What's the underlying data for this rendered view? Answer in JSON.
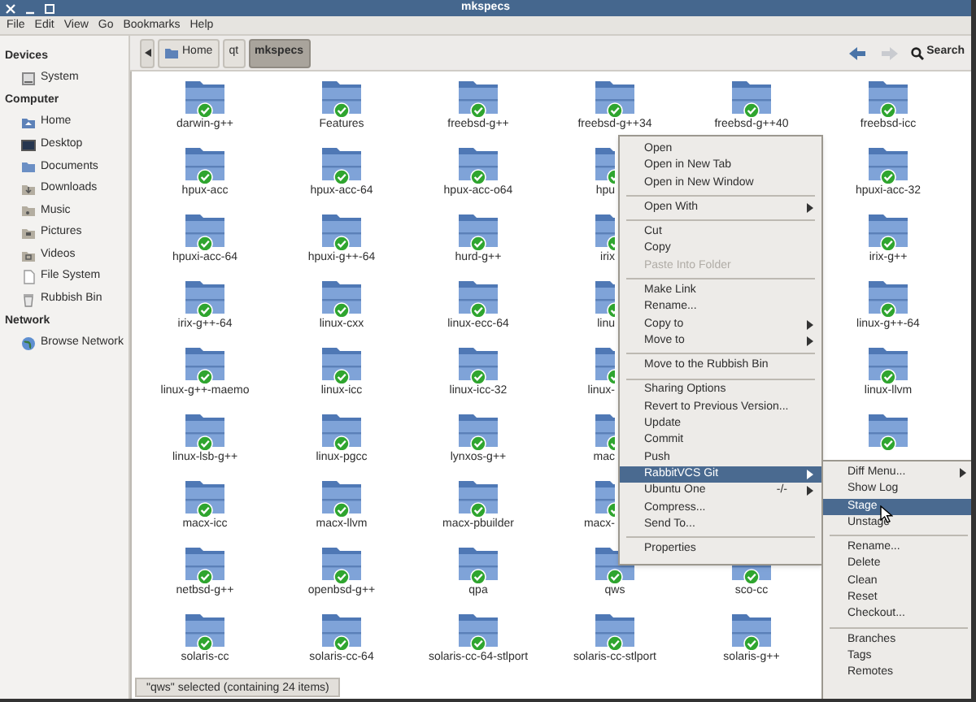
{
  "window": {
    "title": "mkspecs"
  },
  "menu_bar": [
    "File",
    "Edit",
    "View",
    "Go",
    "Bookmarks",
    "Help"
  ],
  "sidebar": [
    {
      "heading": "Devices",
      "items": [
        {
          "label": "System"
        }
      ]
    },
    {
      "heading": "Computer",
      "items": [
        {
          "label": "Home"
        },
        {
          "label": "Desktop"
        },
        {
          "label": "Documents"
        },
        {
          "label": "Downloads"
        },
        {
          "label": "Music"
        },
        {
          "label": "Pictures"
        },
        {
          "label": "Videos"
        },
        {
          "label": "File System"
        },
        {
          "label": "Rubbish Bin"
        }
      ]
    },
    {
      "heading": "Network",
      "items": [
        {
          "label": "Browse Network"
        }
      ]
    }
  ],
  "path_bar": [
    {
      "label": "Home",
      "selected": false
    },
    {
      "label": "qt",
      "selected": false
    },
    {
      "label": "mkspecs",
      "selected": true
    }
  ],
  "search_button": "Search",
  "folders": [
    {
      "before_menu": [
        {
          "name": "darwin-g++",
          "partial": false
        },
        {
          "name": "Features",
          "partial": false
        },
        {
          "name": "freebsd-g++",
          "partial": false
        },
        {
          "name": "freebsd-g++34",
          "partial": false
        },
        {
          "name": "freebsd-g++40",
          "partial": false
        },
        {
          "name": "freebsd-icc",
          "partial": false
        }
      ]
    },
    {
      "before_menu": [
        {
          "name": "hpux-acc",
          "partial": false
        },
        {
          "name": "hpux-acc-64",
          "partial": false
        },
        {
          "name": "hpux-acc-o64",
          "partial": false
        },
        {
          "name": "hpu",
          "partial": true
        }
      ],
      "after_menu": [
        {
          "name": "hpuxi-acc-32",
          "partial": false
        }
      ]
    },
    {
      "before_menu": [
        {
          "name": "hpuxi-acc-64",
          "partial": false
        },
        {
          "name": "hpuxi-g++-64",
          "partial": false
        },
        {
          "name": "hurd-g++",
          "partial": false
        },
        {
          "name": "irix",
          "partial": true
        }
      ],
      "after_menu": [
        {
          "name": "irix-g++",
          "partial": false
        }
      ]
    },
    {
      "before_menu": [
        {
          "name": "irix-g++-64",
          "partial": false
        },
        {
          "name": "linux-cxx",
          "partial": false
        },
        {
          "name": "linux-ecc-64",
          "partial": false
        },
        {
          "name": "linu",
          "partial": true
        }
      ],
      "after_menu": [
        {
          "name": "linux-g++-64",
          "partial": false
        }
      ]
    },
    {
      "before_menu": [
        {
          "name": "linux-g++-maemo",
          "partial": false
        },
        {
          "name": "linux-icc",
          "partial": false
        },
        {
          "name": "linux-icc-32",
          "partial": false
        },
        {
          "name": "linux-",
          "partial": true
        }
      ],
      "after_menu": [
        {
          "name": "linux-llvm",
          "partial": false
        }
      ]
    },
    {
      "before_menu": [
        {
          "name": "linux-lsb-g++",
          "partial": false
        },
        {
          "name": "linux-pgcc",
          "partial": false
        },
        {
          "name": "lynxos-g++",
          "partial": false
        },
        {
          "name": "mac",
          "partial": true
        }
      ],
      "after_menu": [
        {
          "partial": false
        }
      ]
    },
    {
      "before_menu": [
        {
          "name": "macx-icc",
          "partial": false
        },
        {
          "name": "macx-llvm",
          "partial": false
        },
        {
          "name": "macx-pbuilder",
          "partial": false
        },
        {
          "name": "macx-",
          "partial": true
        }
      ]
    },
    {
      "before_menu": [
        {
          "name": "netbsd-g++",
          "partial": false
        },
        {
          "name": "openbsd-g++",
          "partial": false
        },
        {
          "name": "qpa",
          "partial": false
        },
        {
          "name": "qws",
          "partial": false
        },
        {
          "name": "sco-cc",
          "partial": false
        }
      ]
    },
    {
      "before_menu": [
        {
          "name": "solaris-cc",
          "partial": false
        },
        {
          "name": "solaris-cc-64",
          "partial": false
        },
        {
          "name": "solaris-cc-64-stlport",
          "partial": false
        },
        {
          "name": "solaris-cc-stlport",
          "partial": false
        },
        {
          "name": "solaris-g++",
          "partial": false
        }
      ]
    }
  ],
  "status_bar": "\"qws\" selected (containing 24 items)",
  "context_menu": [
    {
      "kind": "item",
      "label": "Open",
      "has_submenu": false,
      "selected": false,
      "disabled": false
    },
    {
      "kind": "item",
      "label": "Open in New Tab",
      "has_submenu": false,
      "selected": false,
      "disabled": false
    },
    {
      "kind": "item",
      "label": "Open in New Window",
      "has_submenu": false,
      "selected": false,
      "disabled": false
    },
    {
      "kind": "separator"
    },
    {
      "kind": "item",
      "label": "Open With",
      "has_submenu": true,
      "selected": false,
      "disabled": false
    },
    {
      "kind": "separator"
    },
    {
      "kind": "item",
      "label": "Cut",
      "has_submenu": false,
      "selected": false,
      "disabled": false
    },
    {
      "kind": "item",
      "label": "Copy",
      "has_submenu": false,
      "selected": false,
      "disabled": false
    },
    {
      "kind": "item",
      "label": "Paste Into Folder",
      "has_submenu": false,
      "selected": false,
      "disabled": true
    },
    {
      "kind": "separator"
    },
    {
      "kind": "item",
      "label": "Make Link",
      "has_submenu": false,
      "selected": false,
      "disabled": false
    },
    {
      "kind": "item",
      "label": "Rename...",
      "has_submenu": false,
      "selected": false,
      "disabled": false
    },
    {
      "kind": "item",
      "label": "Copy to",
      "has_submenu": true,
      "selected": false,
      "disabled": false
    },
    {
      "kind": "item",
      "label": "Move to",
      "has_submenu": true,
      "selected": false,
      "disabled": false
    },
    {
      "kind": "separator"
    },
    {
      "kind": "item",
      "label": "Move to the Rubbish Bin",
      "has_submenu": false,
      "selected": false,
      "disabled": false
    },
    {
      "kind": "separator"
    },
    {
      "kind": "item",
      "label": "Sharing Options",
      "has_submenu": false,
      "selected": false,
      "disabled": false
    },
    {
      "kind": "item",
      "label": "Revert to Previous Version...",
      "has_submenu": false,
      "selected": false,
      "disabled": false
    },
    {
      "kind": "item",
      "label": "Update",
      "has_submenu": false,
      "selected": false,
      "disabled": false
    },
    {
      "kind": "item",
      "label": "Commit",
      "has_submenu": false,
      "selected": false,
      "disabled": false
    },
    {
      "kind": "item",
      "label": "Push",
      "has_submenu": false,
      "selected": false,
      "disabled": false
    },
    {
      "kind": "item",
      "label": "RabbitVCS Git",
      "has_submenu": true,
      "selected": true,
      "disabled": false
    },
    {
      "kind": "item",
      "label": "Ubuntu One",
      "shortcut": "-/-",
      "has_submenu": true,
      "selected": false,
      "disabled": false
    },
    {
      "kind": "item",
      "label": "Compress...",
      "has_submenu": false,
      "selected": false,
      "disabled": false
    },
    {
      "kind": "item",
      "label": "Send To...",
      "has_submenu": false,
      "selected": false,
      "disabled": false
    },
    {
      "kind": "separator"
    },
    {
      "kind": "item",
      "label": "Properties",
      "has_submenu": false,
      "selected": false,
      "disabled": false
    }
  ],
  "submenu": [
    {
      "kind": "item",
      "label": "Diff Menu...",
      "has_submenu": true,
      "selected": false
    },
    {
      "kind": "item",
      "label": "Show Log",
      "has_submenu": false,
      "selected": false
    },
    {
      "kind": "item",
      "label": "Stage",
      "has_submenu": false,
      "selected": true
    },
    {
      "kind": "item",
      "label": "Unstage",
      "has_submenu": false,
      "selected": false
    },
    {
      "kind": "separator"
    },
    {
      "kind": "item",
      "label": "Rename...",
      "has_submenu": false,
      "selected": false
    },
    {
      "kind": "item",
      "label": "Delete",
      "has_submenu": false,
      "selected": false
    },
    {
      "kind": "item",
      "label": "Clean",
      "has_submenu": false,
      "selected": false
    },
    {
      "kind": "item",
      "label": "Reset",
      "has_submenu": false,
      "selected": false
    },
    {
      "kind": "item",
      "label": "Checkout...",
      "has_submenu": false,
      "selected": false
    },
    {
      "kind": "separator"
    },
    {
      "kind": "item",
      "label": "Branches",
      "has_submenu": false,
      "selected": false
    },
    {
      "kind": "item",
      "label": "Tags",
      "has_submenu": false,
      "selected": false
    },
    {
      "kind": "item",
      "label": "Remotes",
      "has_submenu": false,
      "selected": false
    }
  ]
}
